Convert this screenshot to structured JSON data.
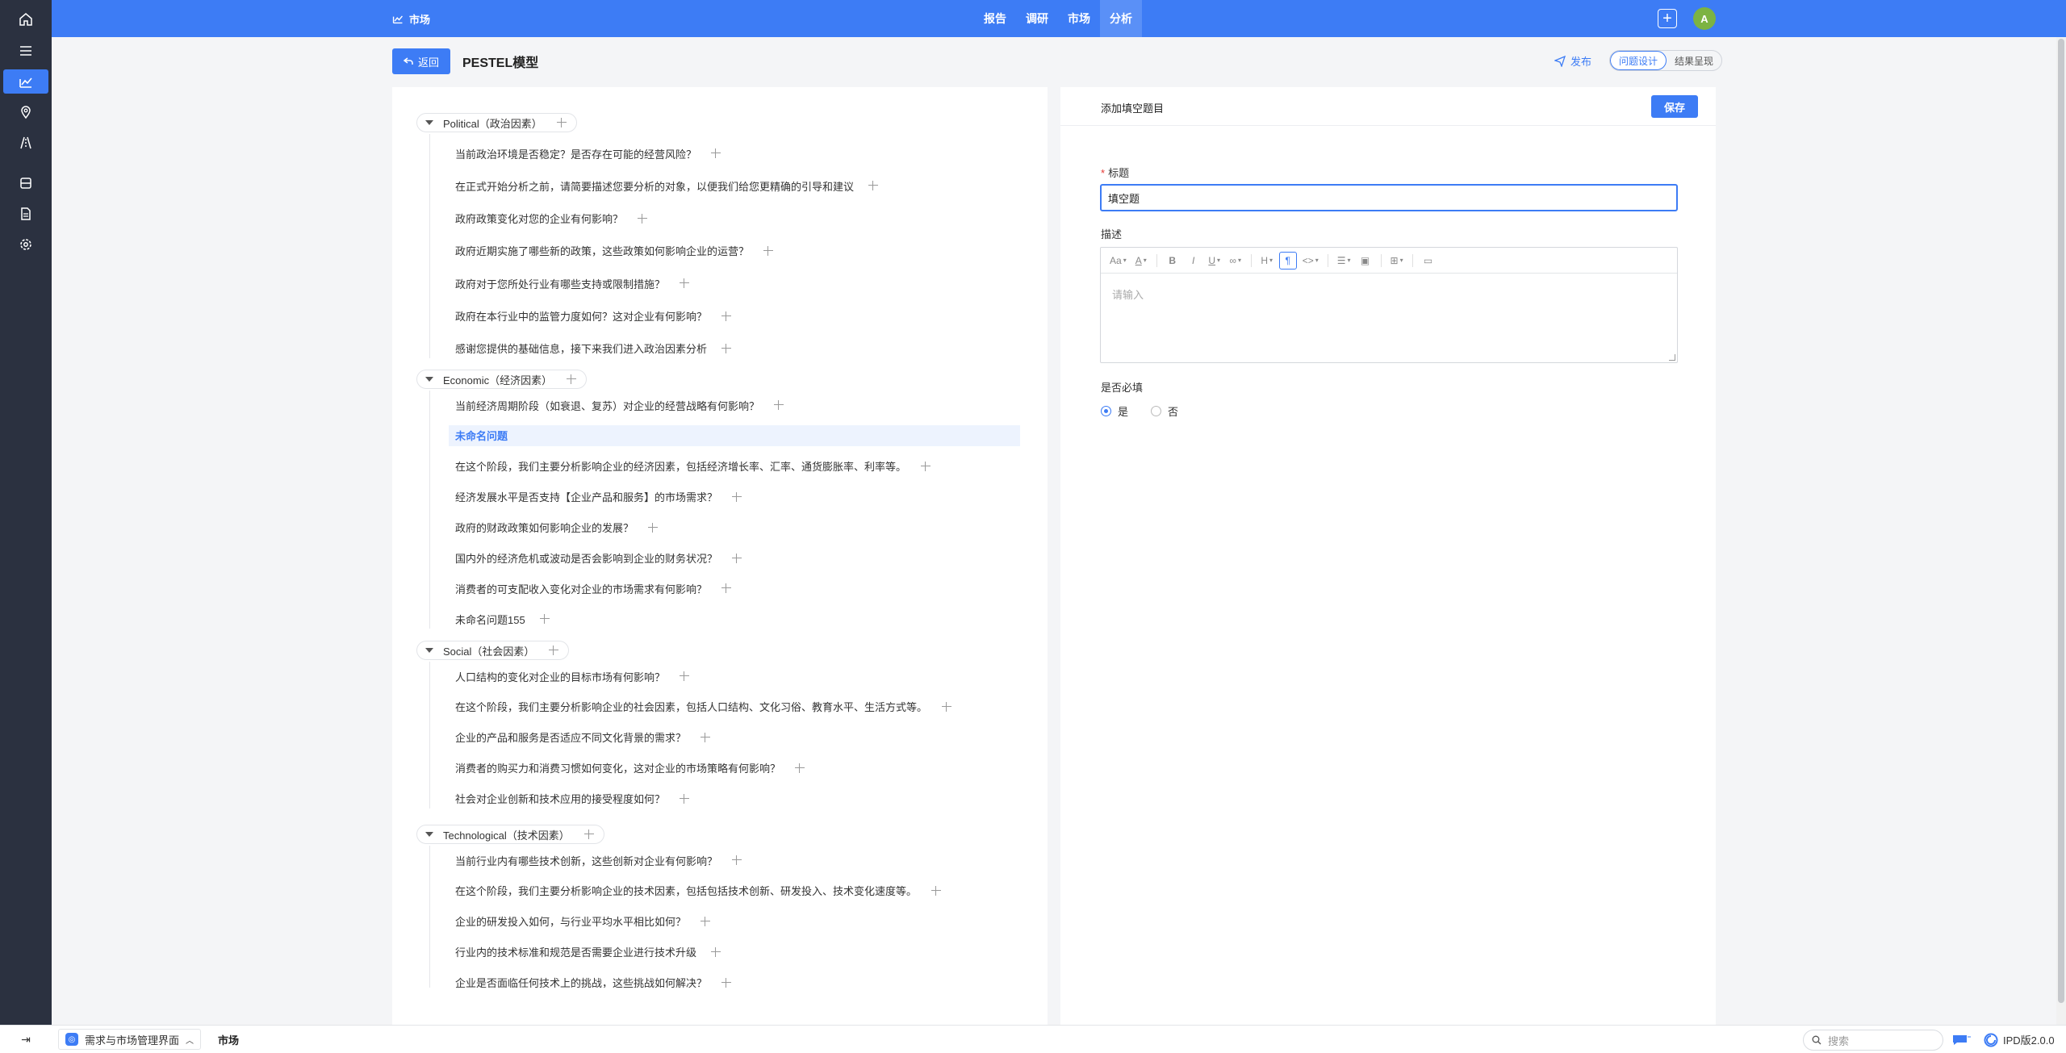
{
  "topbar": {
    "brand": "市场",
    "nav": [
      {
        "label": "报告",
        "active": false
      },
      {
        "label": "调研",
        "active": false
      },
      {
        "label": "市场",
        "active": false
      },
      {
        "label": "分析",
        "active": true
      }
    ],
    "avatar": "A",
    "accent_color": "#3d7cf5"
  },
  "sidebar": {
    "icons": [
      "home-icon",
      "menu-icon",
      "chart-icon",
      "location-icon",
      "road-icon",
      "database-icon",
      "document-icon",
      "settings-icon"
    ],
    "active_index": 2
  },
  "header": {
    "back_label": "返回",
    "title": "PESTEL模型",
    "publish_label": "发布",
    "view_tabs": [
      {
        "label": "问题设计",
        "active": true
      },
      {
        "label": "结果呈现",
        "active": false
      }
    ]
  },
  "tree": {
    "groups": [
      {
        "label": "Political（政治因素）",
        "questions": [
          "当前政治环境是否稳定？是否存在可能的经营风险？",
          "在正式开始分析之前，请简要描述您要分析的对象，以便我们给您更精确的引导和建议",
          "政府政策变化对您的企业有何影响？",
          "政府近期实施了哪些新的政策，这些政策如何影响企业的运营？",
          "政府对于您所处行业有哪些支持或限制措施？",
          "政府在本行业中的监管力度如何？这对企业有何影响？",
          "感谢您提供的基础信息，接下来我们进入政治因素分析"
        ]
      },
      {
        "label": "Economic（经济因素）",
        "questions": [
          "当前经济周期阶段（如衰退、复苏）对企业的经营战略有何影响？",
          "未命名问题",
          "在这个阶段，我们主要分析影响企业的经济因素，包括经济增长率、汇率、通货膨胀率、利率等。",
          "经济发展水平是否支持【企业产品和服务】的市场需求？",
          "政府的财政政策如何影响企业的发展？",
          "国内外的经济危机或波动是否会影响到企业的财务状况？",
          "消费者的可支配收入变化对企业的市场需求有何影响？",
          "未命名问题155"
        ],
        "selected_index": 1
      },
      {
        "label": "Social（社会因素）",
        "questions": [
          "人口结构的变化对企业的目标市场有何影响？",
          "在这个阶段，我们主要分析影响企业的社会因素，包括人口结构、文化习俗、教育水平、生活方式等。",
          "企业的产品和服务是否适应不同文化背景的需求？",
          "消费者的购买力和消费习惯如何变化，这对企业的市场策略有何影响？",
          "社会对企业创新和技术应用的接受程度如何？"
        ]
      },
      {
        "label": "Technological（技术因素）",
        "questions": [
          "当前行业内有哪些技术创新，这些创新对企业有何影响？",
          "在这个阶段，我们主要分析影响企业的技术因素，包括包括技术创新、研发投入、技术变化速度等。",
          "企业的研发投入如何，与行业平均水平相比如何？",
          "行业内的技术标准和规范是否需要企业进行技术升级",
          "企业是否面临任何技术上的挑战，这些挑战如何解决？"
        ]
      }
    ]
  },
  "form": {
    "panel_title": "添加填空题目",
    "save_label": "保存",
    "title_label": "标题",
    "title_value": "填空题",
    "desc_label": "描述",
    "desc_placeholder": "请输入",
    "required_label": "是否必填",
    "required_options": [
      {
        "label": "是",
        "checked": true
      },
      {
        "label": "否",
        "checked": false
      }
    ],
    "toolbar_icons": [
      "font-size-icon",
      "font-color-icon",
      "bold-icon",
      "italic-icon",
      "underline-icon",
      "link-icon",
      "heading-icon",
      "paragraph-icon",
      "code-icon",
      "list-icon",
      "image-icon",
      "table-icon",
      "template-icon"
    ]
  },
  "taskbar": {
    "app_label": "需求与市场管理界面",
    "tab_label": "市场",
    "search_placeholder": "搜索",
    "brand": "IPD版2.0.0"
  }
}
